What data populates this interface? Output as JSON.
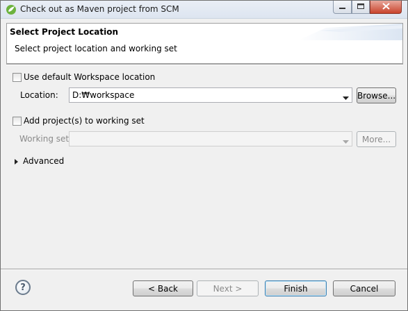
{
  "window": {
    "title": "Check out as Maven project from SCM",
    "icon": "eclipse-spring-icon",
    "controls": {
      "minimize_icon": "minimize-icon",
      "maximize_icon": "maximize-icon",
      "close_icon": "close-icon"
    }
  },
  "header": {
    "title": "Select Project Location",
    "description": "Select project location and working set"
  },
  "workspace": {
    "use_default_label": "Use default Workspace location",
    "use_default_checked": false,
    "location_label": "Location:",
    "location_value": "D:₩workspace",
    "browse_label": "Browse..."
  },
  "working_set": {
    "add_label": "Add project(s) to working set",
    "add_checked": false,
    "working_set_label": "Working set:",
    "working_set_value": "",
    "more_label": "More..."
  },
  "advanced": {
    "label": "Advanced",
    "expanded": false
  },
  "footer": {
    "help_icon": "help-icon",
    "help_glyph": "?",
    "back_label": "< Back",
    "next_label": "Next >",
    "finish_label": "Finish",
    "cancel_label": "Cancel"
  },
  "colors": {
    "window_bg": "#f0f0f0",
    "titlebar": "#dde5f0",
    "close_button": "#c9442c",
    "default_button_border": "#3c7fb1"
  }
}
